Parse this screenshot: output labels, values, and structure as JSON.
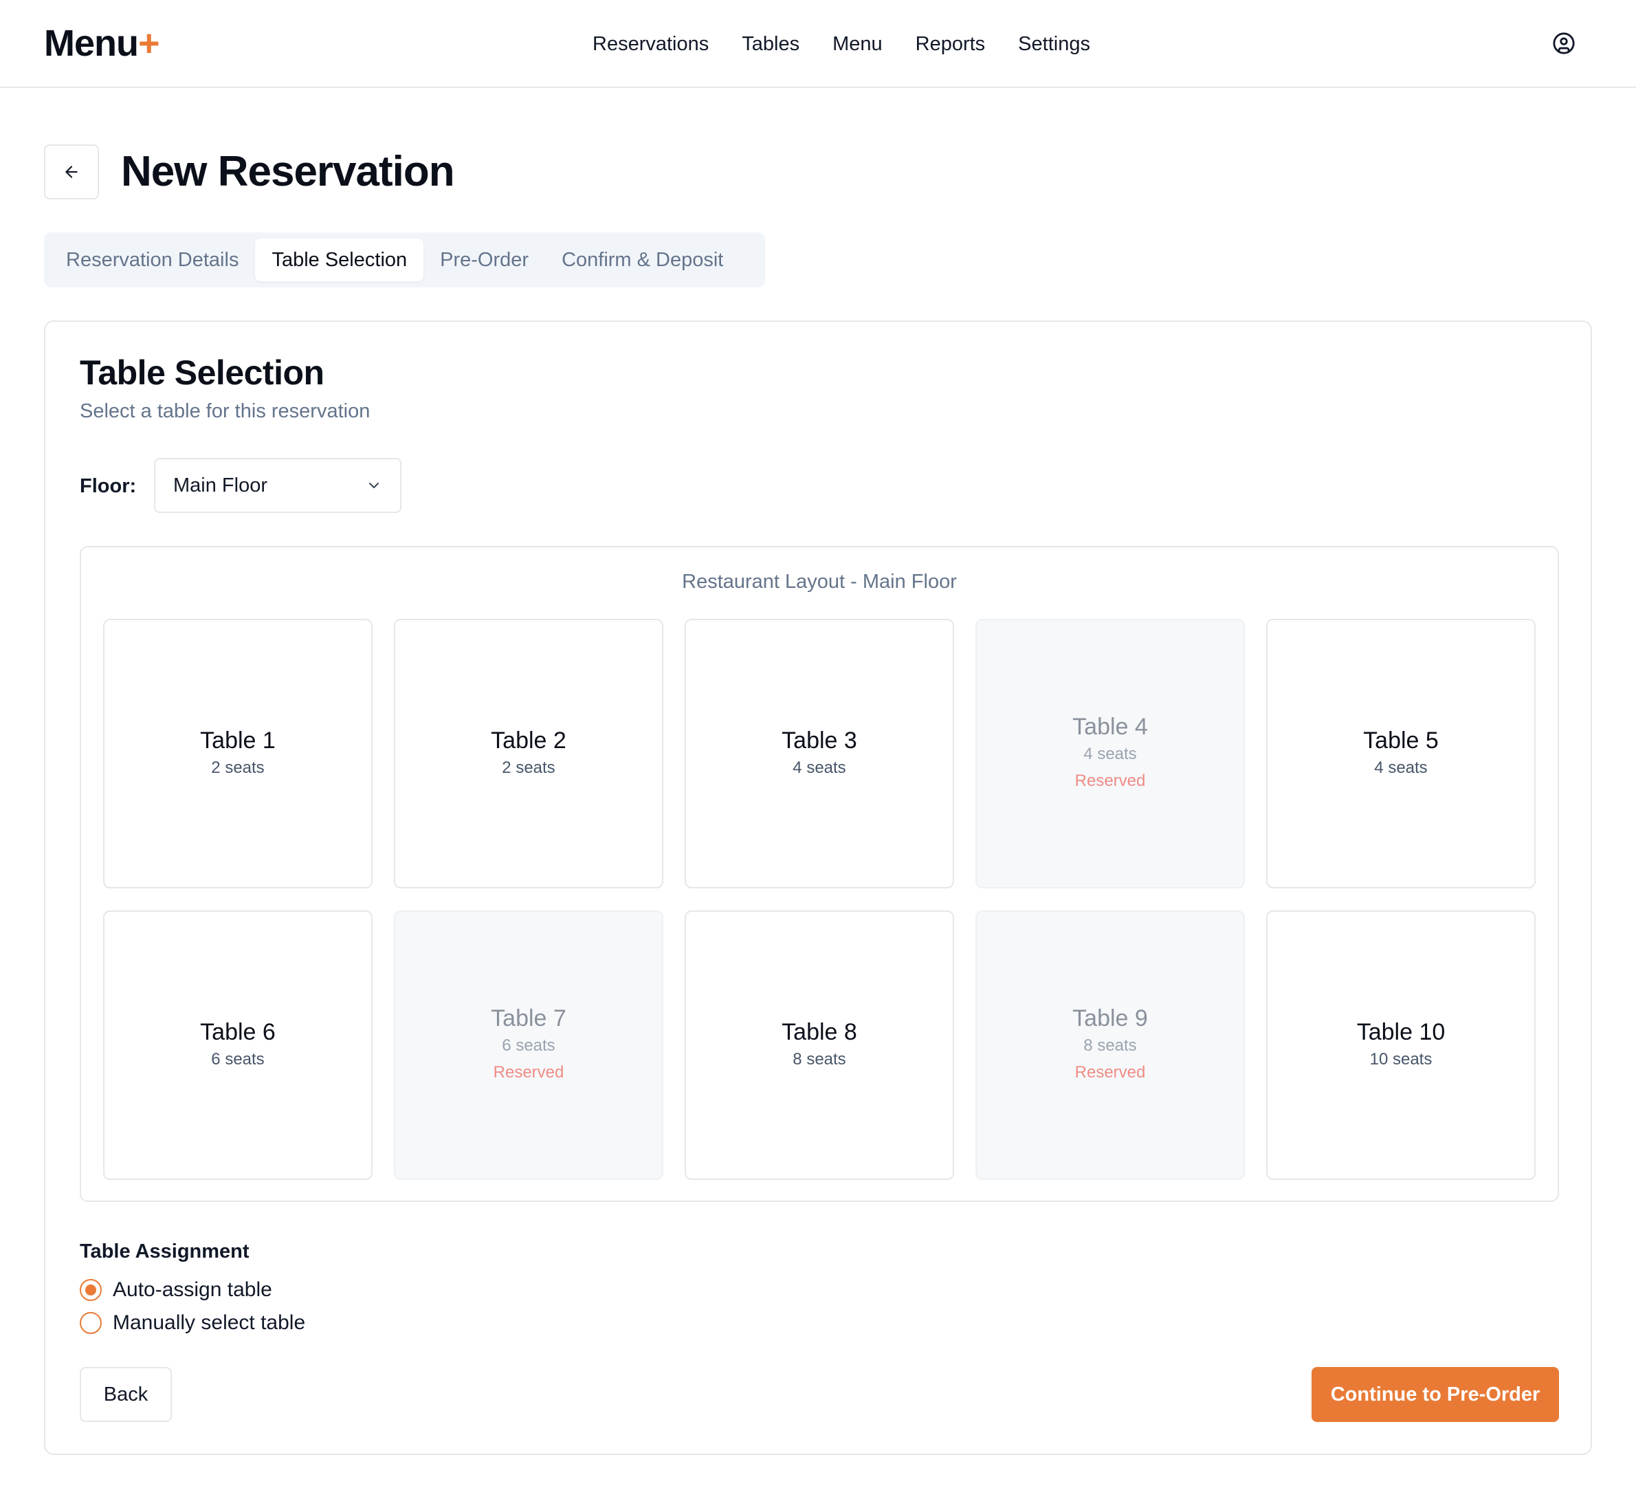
{
  "app": {
    "logo_text": "Menu",
    "logo_plus": "+",
    "accent_color": "#ea7a35"
  },
  "nav": {
    "items": [
      {
        "label": "Reservations"
      },
      {
        "label": "Tables"
      },
      {
        "label": "Menu"
      },
      {
        "label": "Reports"
      },
      {
        "label": "Settings"
      }
    ],
    "user_icon": "user-circle-icon"
  },
  "page": {
    "title": "New Reservation",
    "back_icon": "arrow-left-icon"
  },
  "steps": {
    "items": [
      {
        "label": "Reservation Details",
        "active": false
      },
      {
        "label": "Table Selection",
        "active": true
      },
      {
        "label": "Pre-Order",
        "active": false
      },
      {
        "label": "Confirm & Deposit",
        "active": false
      }
    ]
  },
  "card": {
    "title": "Table Selection",
    "subtitle": "Select a table for this reservation",
    "floor_label": "Floor:",
    "floor_value": "Main Floor",
    "layout_title": "Restaurant Layout - Main Floor",
    "tables": [
      {
        "name": "Table 1",
        "seats": "2 seats",
        "reserved": false,
        "status": ""
      },
      {
        "name": "Table 2",
        "seats": "2 seats",
        "reserved": false,
        "status": ""
      },
      {
        "name": "Table 3",
        "seats": "4 seats",
        "reserved": false,
        "status": ""
      },
      {
        "name": "Table 4",
        "seats": "4 seats",
        "reserved": true,
        "status": "Reserved"
      },
      {
        "name": "Table 5",
        "seats": "4 seats",
        "reserved": false,
        "status": ""
      },
      {
        "name": "Table 6",
        "seats": "6 seats",
        "reserved": false,
        "status": ""
      },
      {
        "name": "Table 7",
        "seats": "6 seats",
        "reserved": true,
        "status": "Reserved"
      },
      {
        "name": "Table 8",
        "seats": "8 seats",
        "reserved": false,
        "status": ""
      },
      {
        "name": "Table 9",
        "seats": "8 seats",
        "reserved": true,
        "status": "Reserved"
      },
      {
        "name": "Table 10",
        "seats": "10 seats",
        "reserved": false,
        "status": ""
      }
    ],
    "assignment": {
      "title": "Table Assignment",
      "options": [
        {
          "label": "Auto-assign table",
          "checked": true
        },
        {
          "label": "Manually select table",
          "checked": false
        }
      ]
    },
    "back_label": "Back",
    "continue_label": "Continue to Pre-Order"
  }
}
